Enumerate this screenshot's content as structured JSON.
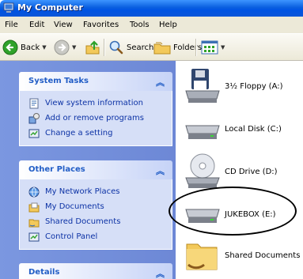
{
  "window": {
    "title": "My Computer"
  },
  "menu": [
    "File",
    "Edit",
    "View",
    "Favorites",
    "Tools",
    "Help"
  ],
  "toolbar": {
    "back": "Back",
    "search": "Search",
    "folders": "Folders"
  },
  "panels": {
    "system_tasks": {
      "title": "System Tasks",
      "items": [
        "View system information",
        "Add or remove programs",
        "Change a setting"
      ]
    },
    "other_places": {
      "title": "Other Places",
      "items": [
        "My Network Places",
        "My Documents",
        "Shared Documents",
        "Control Panel"
      ]
    },
    "details": {
      "title": "Details"
    }
  },
  "drives": [
    "3½ Floppy (A:)",
    "Local Disk (C:)",
    "CD Drive (D:)",
    "JUKEBOX (E:)",
    "Shared Documents"
  ],
  "icons": {
    "title": "my-computer-icon",
    "back": "back-arrow-icon",
    "forward": "forward-arrow-icon",
    "up": "up-folder-icon",
    "search": "search-icon",
    "folders": "folders-icon",
    "views": "views-icon"
  }
}
